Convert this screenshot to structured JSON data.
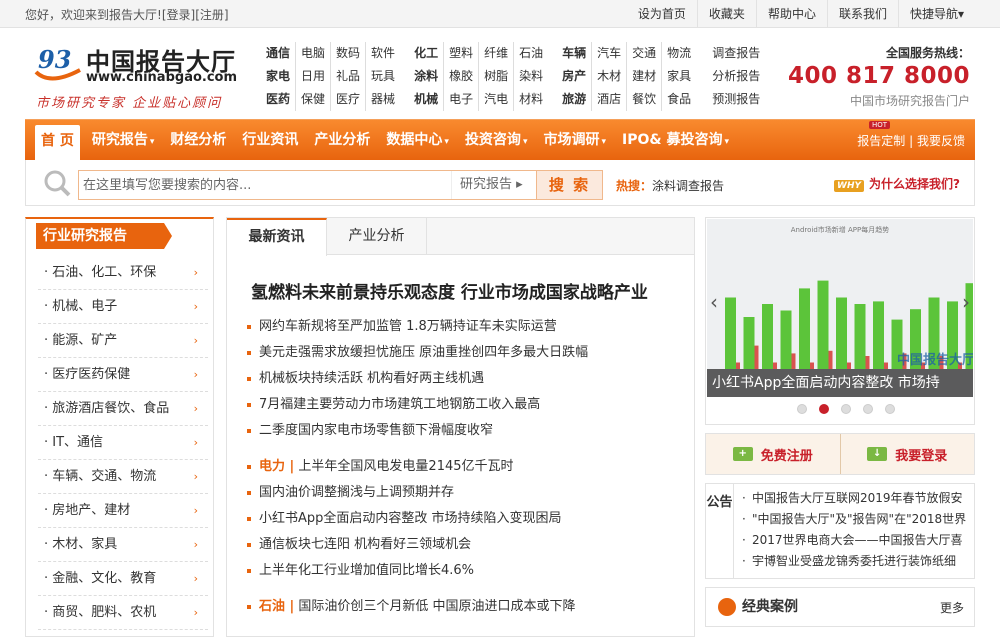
{
  "topbar": {
    "welcome": "您好，欢迎来到报告大厅!",
    "login": "[登录]",
    "register": "[注册]",
    "links": [
      "设为首页",
      "收藏夹",
      "帮助中心",
      "联系我们",
      "快捷导航▾"
    ]
  },
  "logo": {
    "name": "中国报告大厅",
    "url": "www.chinabgao.com",
    "slogan": "市场研究专家 企业贴心顾问"
  },
  "categories": {
    "group1": [
      "通信",
      "电脑",
      "数码",
      "软件",
      "家电",
      "日用",
      "礼品",
      "玩具",
      "医药",
      "保健",
      "医疗",
      "器械"
    ],
    "group2": [
      "化工",
      "塑料",
      "纤维",
      "石油",
      "涂料",
      "橡胶",
      "树脂",
      "染料",
      "机械",
      "电子",
      "汽电",
      "材料"
    ],
    "group3": [
      "车辆",
      "汽车",
      "交通",
      "物流",
      "房产",
      "木材",
      "建材",
      "家具",
      "旅游",
      "酒店",
      "餐饮",
      "食品"
    ],
    "links": [
      "调查报告",
      "分析报告",
      "预测报告"
    ]
  },
  "hotline": {
    "title": "全国服务热线：",
    "number": "400 817 8000",
    "sub": "中国市场研究报告门户"
  },
  "nav": {
    "items": [
      "首 页",
      "研究报告",
      "财经分析",
      "行业资讯",
      "产业分析",
      "数据中心",
      "投资咨询",
      "市场调研",
      "IPO& 募投咨询"
    ],
    "has_caret": [
      false,
      true,
      false,
      false,
      false,
      true,
      true,
      true,
      true
    ],
    "hot": "HOT",
    "custom": "报告定制",
    "feedback": "我要反馈"
  },
  "search": {
    "placeholder": "在这里填写您要搜索的内容...",
    "category": "研究报告 ▸",
    "button": "搜 索",
    "hot_label": "热搜：",
    "hot_word": "涂料调查报告",
    "why_badge": "WHY",
    "why_text": "为什么选择我们?"
  },
  "industry": {
    "title": "行业研究报告",
    "items": [
      "石油、化工、环保",
      "机械、电子",
      "能源、矿产",
      "医疗医药保健",
      "旅游酒店餐饮、食品",
      "IT、通信",
      "车辆、交通、物流",
      "房地产、建材",
      "木材、家具",
      "金融、文化、教育",
      "商贸、肥料、农机"
    ]
  },
  "news": {
    "tabs": [
      "最新资讯",
      "产业分析"
    ],
    "headline": "氢燃料未来前景持乐观态度 行业市场成国家战略产业",
    "block1": [
      "网约车新规将至严加监管 1.8万辆持证车未实际运营",
      "美元走强需求放缓担忧施压 原油重挫创四年多最大日跌幅",
      "机械板块持续活跃 机构看好两主线机遇",
      "7月福建主要劳动力市场建筑工地钢筋工收入最高",
      "二季度国内家电市场零售额下滑幅度收窄"
    ],
    "block2_cat": "电力 |",
    "block2_first": "上半年全国风电发电量2145亿千瓦时",
    "block2": [
      "国内油价调整搁浅与上调预期并存",
      "小红书App全面启动内容整改 市场持续陷入变现困局",
      "通信板块七连阳 机构看好三领域机会",
      "上半年化工行业增加值同比增长4.6%"
    ],
    "block3_cat": "石油 |",
    "block3_first": "国际油价创三个月新低 中国原油进口成本或下降"
  },
  "slider": {
    "caption": "小红书App全面启动内容整改 市场持",
    "chart_title": "Android市场新增 APP每月趋势",
    "watermark": "中国报告大厅",
    "active_dot": 1,
    "dot_count": 5,
    "bars_green": [
      0.55,
      0.4,
      0.5,
      0.45,
      0.62,
      0.68,
      0.55,
      0.5,
      0.52,
      0.38,
      0.46,
      0.55,
      0.52,
      0.66
    ],
    "bars_red": [
      0.05,
      0.18,
      0.05,
      0.12,
      0.05,
      0.14,
      0.05,
      0.1,
      0.05,
      0.12,
      0.05,
      0.1,
      0.05,
      0.08
    ]
  },
  "account": {
    "register": "免费注册",
    "login": "我要登录"
  },
  "notice": {
    "label": "公告",
    "items": [
      "中国报告大厅互联网2019年春节放假安",
      "\"中国报告大厅\"及\"报告网\"在\"2018世界",
      "2017世界电商大会——中国报告大厅喜",
      "宇博智业受盛龙锦秀委托进行装饰纸细"
    ]
  },
  "cases": {
    "title": "经典案例",
    "more": "更多"
  },
  "colors": {
    "accent": "#e8640e",
    "red": "#c8202a",
    "green": "#5cc43a"
  }
}
